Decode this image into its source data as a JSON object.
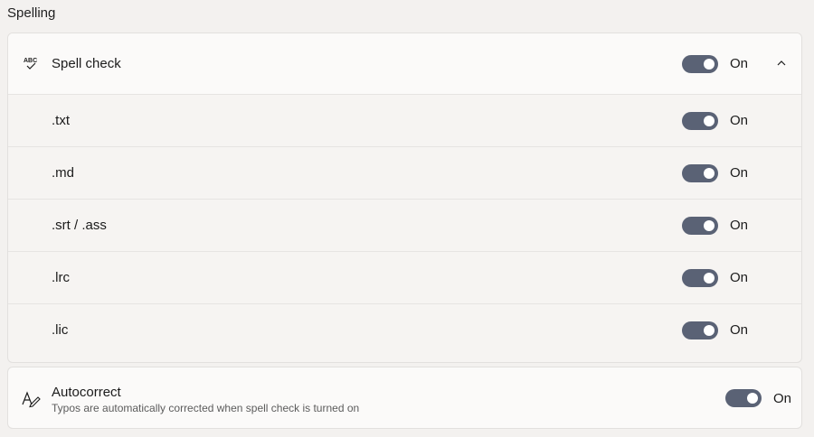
{
  "section": {
    "title": "Spelling"
  },
  "spell_check": {
    "icon": "spell-check-abc-icon",
    "label": "Spell check",
    "toggle_state": "On",
    "expanded": true,
    "items": [
      {
        "label": ".txt",
        "toggle_state": "On"
      },
      {
        "label": ".md",
        "toggle_state": "On"
      },
      {
        "label": ".srt / .ass",
        "toggle_state": "On"
      },
      {
        "label": ".lrc",
        "toggle_state": "On"
      },
      {
        "label": ".lic",
        "toggle_state": "On"
      }
    ]
  },
  "autocorrect": {
    "icon": "autocorrect-pen-icon",
    "title": "Autocorrect",
    "description": "Typos are automatically corrected when spell check is turned on",
    "toggle_state": "On"
  },
  "colors": {
    "toggle_on": "#5a6275",
    "background": "#f3f1ef",
    "card_header": "#fbfaf9"
  }
}
